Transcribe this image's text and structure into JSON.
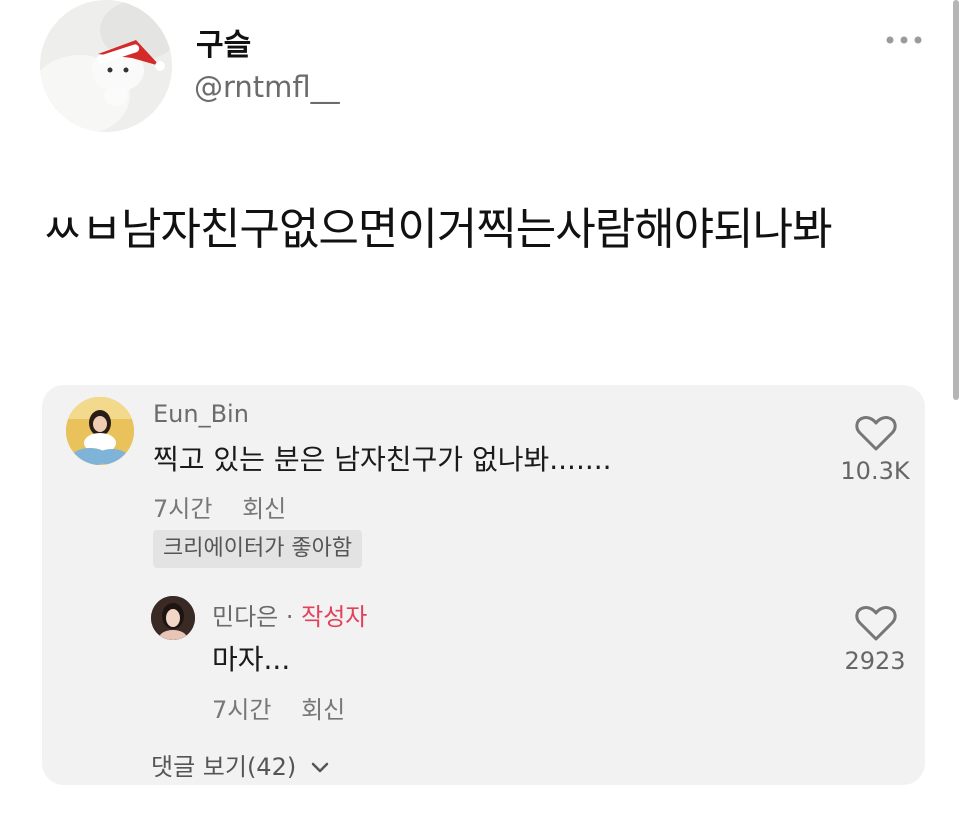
{
  "tweet": {
    "display_name": "구슬",
    "handle": "@rntmfl__",
    "text": "ㅆㅂ남자친구없으면이거찍는사람해야되나봐"
  },
  "embedded_comments": {
    "comment1": {
      "username": "Eun_Bin",
      "text": "찍고 있는 분은 남자친구가 없나봐.......",
      "time": "7시간",
      "reply_label": "회신",
      "badge": "크리에이터가 좋아함",
      "like_count": "10.3K"
    },
    "comment2": {
      "username": "민다은 · ",
      "author_tag": "작성자",
      "text": "마자...",
      "time": "7시간",
      "reply_label": "회신",
      "like_count": "2923"
    },
    "view_replies": "댓글 보기(42)"
  },
  "icons": {
    "more": "more-horizontal-icon",
    "heart": "heart-outline-icon",
    "chevron": "chevron-down-icon"
  },
  "colors": {
    "author_tag": "#e3405b",
    "card_background": "#f2f2f2"
  }
}
